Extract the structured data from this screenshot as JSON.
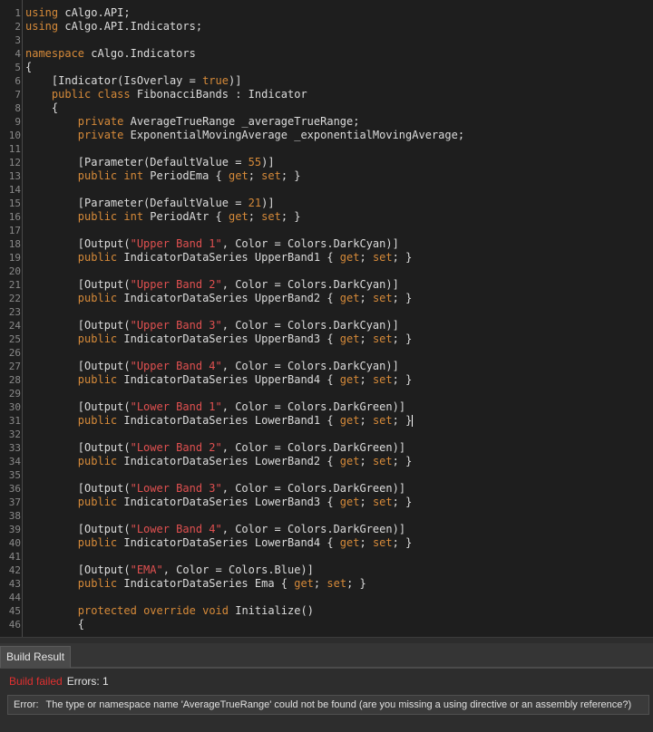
{
  "editor": {
    "lines": [
      {
        "n": "1",
        "tokens": [
          {
            "t": "using",
            "c": "kw"
          },
          {
            "t": " cAlgo.API;"
          }
        ]
      },
      {
        "n": "2",
        "tokens": [
          {
            "t": "using",
            "c": "kw"
          },
          {
            "t": " cAlgo.API.Indicators;"
          }
        ]
      },
      {
        "n": "3",
        "tokens": []
      },
      {
        "n": "4",
        "tokens": [
          {
            "t": "namespace",
            "c": "kw"
          },
          {
            "t": " cAlgo.Indicators"
          }
        ]
      },
      {
        "n": "5",
        "tokens": [
          {
            "t": "{"
          }
        ]
      },
      {
        "n": "6",
        "tokens": [
          {
            "t": "    [Indicator(IsOverlay = "
          },
          {
            "t": "true",
            "c": "kw"
          },
          {
            "t": ")]"
          }
        ]
      },
      {
        "n": "7",
        "tokens": [
          {
            "t": "    "
          },
          {
            "t": "public",
            "c": "kw"
          },
          {
            "t": " "
          },
          {
            "t": "class",
            "c": "kw"
          },
          {
            "t": " FibonacciBands : Indicator"
          }
        ]
      },
      {
        "n": "8",
        "tokens": [
          {
            "t": "    {"
          }
        ]
      },
      {
        "n": "9",
        "tokens": [
          {
            "t": "        "
          },
          {
            "t": "private",
            "c": "kw"
          },
          {
            "t": " AverageTrueRange _averageTrueRange;"
          }
        ]
      },
      {
        "n": "10",
        "tokens": [
          {
            "t": "        "
          },
          {
            "t": "private",
            "c": "kw"
          },
          {
            "t": " ExponentialMovingAverage _exponentialMovingAverage;"
          }
        ]
      },
      {
        "n": "11",
        "tokens": []
      },
      {
        "n": "12",
        "tokens": [
          {
            "t": "        [Parameter(DefaultValue = "
          },
          {
            "t": "55",
            "c": "num"
          },
          {
            "t": ")]"
          }
        ]
      },
      {
        "n": "13",
        "tokens": [
          {
            "t": "        "
          },
          {
            "t": "public",
            "c": "kw"
          },
          {
            "t": " "
          },
          {
            "t": "int",
            "c": "kw"
          },
          {
            "t": " PeriodEma { "
          },
          {
            "t": "get",
            "c": "kw"
          },
          {
            "t": "; "
          },
          {
            "t": "set",
            "c": "kw"
          },
          {
            "t": "; }"
          }
        ]
      },
      {
        "n": "14",
        "tokens": []
      },
      {
        "n": "15",
        "tokens": [
          {
            "t": "        [Parameter(DefaultValue = "
          },
          {
            "t": "21",
            "c": "num"
          },
          {
            "t": ")]"
          }
        ]
      },
      {
        "n": "16",
        "tokens": [
          {
            "t": "        "
          },
          {
            "t": "public",
            "c": "kw"
          },
          {
            "t": " "
          },
          {
            "t": "int",
            "c": "kw"
          },
          {
            "t": " PeriodAtr { "
          },
          {
            "t": "get",
            "c": "kw"
          },
          {
            "t": "; "
          },
          {
            "t": "set",
            "c": "kw"
          },
          {
            "t": "; }"
          }
        ]
      },
      {
        "n": "17",
        "tokens": []
      },
      {
        "n": "18",
        "tokens": [
          {
            "t": "        [Output("
          },
          {
            "t": "\"Upper Band 1\"",
            "c": "str"
          },
          {
            "t": ", Color = Colors.DarkCyan)]"
          }
        ]
      },
      {
        "n": "19",
        "tokens": [
          {
            "t": "        "
          },
          {
            "t": "public",
            "c": "kw"
          },
          {
            "t": " IndicatorDataSeries UpperBand1 { "
          },
          {
            "t": "get",
            "c": "kw"
          },
          {
            "t": "; "
          },
          {
            "t": "set",
            "c": "kw"
          },
          {
            "t": "; }"
          }
        ]
      },
      {
        "n": "20",
        "tokens": []
      },
      {
        "n": "21",
        "tokens": [
          {
            "t": "        [Output("
          },
          {
            "t": "\"Upper Band 2\"",
            "c": "str"
          },
          {
            "t": ", Color = Colors.DarkCyan)]"
          }
        ]
      },
      {
        "n": "22",
        "tokens": [
          {
            "t": "        "
          },
          {
            "t": "public",
            "c": "kw"
          },
          {
            "t": " IndicatorDataSeries UpperBand2 { "
          },
          {
            "t": "get",
            "c": "kw"
          },
          {
            "t": "; "
          },
          {
            "t": "set",
            "c": "kw"
          },
          {
            "t": "; }"
          }
        ]
      },
      {
        "n": "23",
        "tokens": []
      },
      {
        "n": "24",
        "tokens": [
          {
            "t": "        [Output("
          },
          {
            "t": "\"Upper Band 3\"",
            "c": "str"
          },
          {
            "t": ", Color = Colors.DarkCyan)]"
          }
        ]
      },
      {
        "n": "25",
        "tokens": [
          {
            "t": "        "
          },
          {
            "t": "public",
            "c": "kw"
          },
          {
            "t": " IndicatorDataSeries UpperBand3 { "
          },
          {
            "t": "get",
            "c": "kw"
          },
          {
            "t": "; "
          },
          {
            "t": "set",
            "c": "kw"
          },
          {
            "t": "; }"
          }
        ]
      },
      {
        "n": "26",
        "tokens": []
      },
      {
        "n": "27",
        "tokens": [
          {
            "t": "        [Output("
          },
          {
            "t": "\"Upper Band 4\"",
            "c": "str"
          },
          {
            "t": ", Color = Colors.DarkCyan)]"
          }
        ]
      },
      {
        "n": "28",
        "tokens": [
          {
            "t": "        "
          },
          {
            "t": "public",
            "c": "kw"
          },
          {
            "t": " IndicatorDataSeries UpperBand4 { "
          },
          {
            "t": "get",
            "c": "kw"
          },
          {
            "t": "; "
          },
          {
            "t": "set",
            "c": "kw"
          },
          {
            "t": "; }"
          }
        ]
      },
      {
        "n": "29",
        "tokens": []
      },
      {
        "n": "30",
        "tokens": [
          {
            "t": "        [Output("
          },
          {
            "t": "\"Lower Band 1\"",
            "c": "str"
          },
          {
            "t": ", Color = Colors.DarkGreen)]"
          }
        ]
      },
      {
        "n": "31",
        "tokens": [
          {
            "t": "        "
          },
          {
            "t": "public",
            "c": "kw"
          },
          {
            "t": " IndicatorDataSeries LowerBand1 { "
          },
          {
            "t": "get",
            "c": "kw"
          },
          {
            "t": "; "
          },
          {
            "t": "set",
            "c": "kw"
          },
          {
            "t": "; }"
          }
        ],
        "cursor": true
      },
      {
        "n": "32",
        "tokens": []
      },
      {
        "n": "33",
        "tokens": [
          {
            "t": "        [Output("
          },
          {
            "t": "\"Lower Band 2\"",
            "c": "str"
          },
          {
            "t": ", Color = Colors.DarkGreen)]"
          }
        ]
      },
      {
        "n": "34",
        "tokens": [
          {
            "t": "        "
          },
          {
            "t": "public",
            "c": "kw"
          },
          {
            "t": " IndicatorDataSeries LowerBand2 { "
          },
          {
            "t": "get",
            "c": "kw"
          },
          {
            "t": "; "
          },
          {
            "t": "set",
            "c": "kw"
          },
          {
            "t": "; }"
          }
        ]
      },
      {
        "n": "35",
        "tokens": []
      },
      {
        "n": "36",
        "tokens": [
          {
            "t": "        [Output("
          },
          {
            "t": "\"Lower Band 3\"",
            "c": "str"
          },
          {
            "t": ", Color = Colors.DarkGreen)]"
          }
        ]
      },
      {
        "n": "37",
        "tokens": [
          {
            "t": "        "
          },
          {
            "t": "public",
            "c": "kw"
          },
          {
            "t": " IndicatorDataSeries LowerBand3 { "
          },
          {
            "t": "get",
            "c": "kw"
          },
          {
            "t": "; "
          },
          {
            "t": "set",
            "c": "kw"
          },
          {
            "t": "; }"
          }
        ]
      },
      {
        "n": "38",
        "tokens": []
      },
      {
        "n": "39",
        "tokens": [
          {
            "t": "        [Output("
          },
          {
            "t": "\"Lower Band 4\"",
            "c": "str"
          },
          {
            "t": ", Color = Colors.DarkGreen)]"
          }
        ]
      },
      {
        "n": "40",
        "tokens": [
          {
            "t": "        "
          },
          {
            "t": "public",
            "c": "kw"
          },
          {
            "t": " IndicatorDataSeries LowerBand4 { "
          },
          {
            "t": "get",
            "c": "kw"
          },
          {
            "t": "; "
          },
          {
            "t": "set",
            "c": "kw"
          },
          {
            "t": "; }"
          }
        ]
      },
      {
        "n": "41",
        "tokens": []
      },
      {
        "n": "42",
        "tokens": [
          {
            "t": "        [Output("
          },
          {
            "t": "\"EMA\"",
            "c": "str"
          },
          {
            "t": ", Color = Colors.Blue)]"
          }
        ]
      },
      {
        "n": "43",
        "tokens": [
          {
            "t": "        "
          },
          {
            "t": "public",
            "c": "kw"
          },
          {
            "t": " IndicatorDataSeries Ema { "
          },
          {
            "t": "get",
            "c": "kw"
          },
          {
            "t": "; "
          },
          {
            "t": "set",
            "c": "kw"
          },
          {
            "t": "; }"
          }
        ]
      },
      {
        "n": "44",
        "tokens": []
      },
      {
        "n": "45",
        "tokens": [
          {
            "t": "        "
          },
          {
            "t": "protected",
            "c": "kw"
          },
          {
            "t": " "
          },
          {
            "t": "override",
            "c": "kw"
          },
          {
            "t": " "
          },
          {
            "t": "void",
            "c": "kw"
          },
          {
            "t": " Initialize()"
          }
        ]
      },
      {
        "n": "46",
        "tokens": [
          {
            "t": "        {"
          }
        ]
      }
    ]
  },
  "build": {
    "tab_label": "Build Result",
    "status_label": "Build failed",
    "errors_label": "Errors: 1",
    "error_prefix": "Error:",
    "error_message": "The type or namespace name 'AverageTrueRange' could not be found (are you missing a using directive or an assembly reference?)"
  },
  "colors": {
    "keyword": "#d68a39",
    "string": "#e05050",
    "editor_bg": "#1e1e1e",
    "failed": "#e03030"
  }
}
